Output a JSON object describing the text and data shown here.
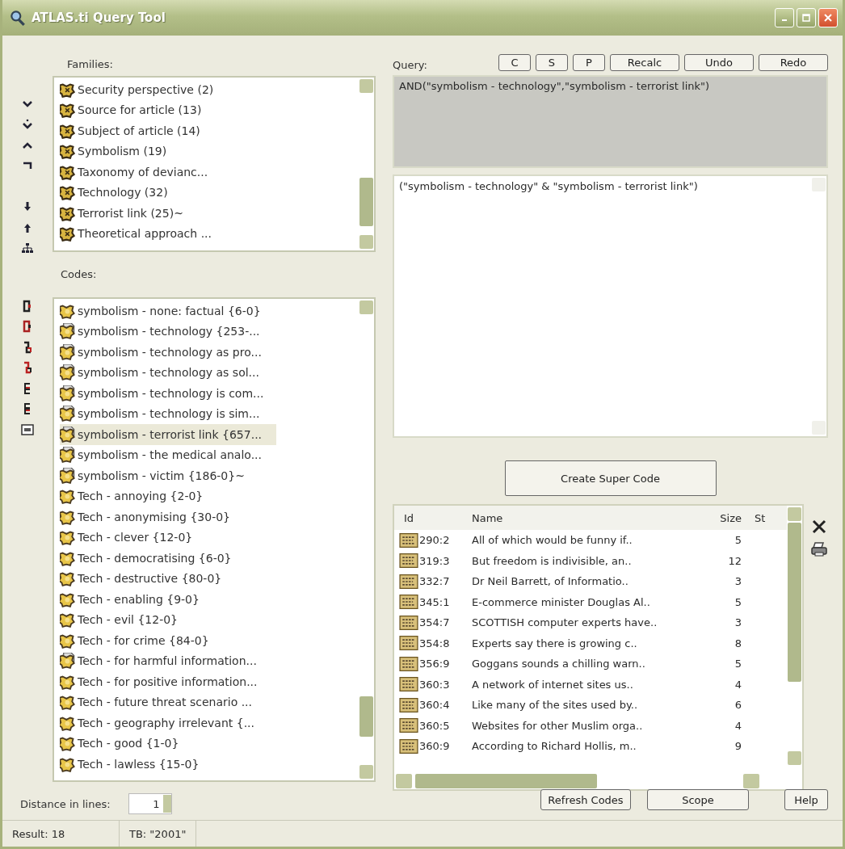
{
  "window": {
    "title": "ATLAS.ti Query Tool"
  },
  "families": {
    "label": "Families:",
    "items": [
      {
        "label": "Security perspective (2)"
      },
      {
        "label": "Source for article (13)"
      },
      {
        "label": "Subject of article (14)"
      },
      {
        "label": "Symbolism (19)"
      },
      {
        "label": "Taxonomy of devianc..."
      },
      {
        "label": "Technology (32)"
      },
      {
        "label": "Terrorist link (25)~"
      },
      {
        "label": "Theoretical approach ..."
      }
    ]
  },
  "codes": {
    "label": "Codes:",
    "items": [
      {
        "label": "symbolism - none: factual {6-0}",
        "commented": false,
        "selected": false
      },
      {
        "label": "symbolism - technology {253-...",
        "commented": true,
        "selected": false
      },
      {
        "label": "symbolism - technology as pro...",
        "commented": true,
        "selected": false
      },
      {
        "label": "symbolism - technology as sol...",
        "commented": true,
        "selected": false
      },
      {
        "label": "symbolism - technology is com...",
        "commented": true,
        "selected": false
      },
      {
        "label": "symbolism - technology is sim...",
        "commented": true,
        "selected": false
      },
      {
        "label": "symbolism - terrorist link {657...",
        "commented": true,
        "selected": true
      },
      {
        "label": "symbolism - the medical analo...",
        "commented": true,
        "selected": false
      },
      {
        "label": "symbolism - victim {186-0}~",
        "commented": true,
        "selected": false
      },
      {
        "label": "Tech - annoying {2-0}",
        "commented": false,
        "selected": false
      },
      {
        "label": "Tech - anonymising {30-0}",
        "commented": false,
        "selected": false
      },
      {
        "label": "Tech - clever {12-0}",
        "commented": false,
        "selected": false
      },
      {
        "label": "Tech - democratising {6-0}",
        "commented": false,
        "selected": false
      },
      {
        "label": "Tech - destructive {80-0}",
        "commented": false,
        "selected": false
      },
      {
        "label": "Tech - enabling {9-0}",
        "commented": false,
        "selected": false
      },
      {
        "label": "Tech - evil {12-0}",
        "commented": false,
        "selected": false
      },
      {
        "label": "Tech - for crime {84-0}",
        "commented": false,
        "selected": false
      },
      {
        "label": "Tech - for harmful information...",
        "commented": true,
        "selected": false
      },
      {
        "label": "Tech - for positive information...",
        "commented": false,
        "selected": false
      },
      {
        "label": "Tech - future threat scenario ...",
        "commented": false,
        "selected": false
      },
      {
        "label": "Tech - geography irrelevant {...",
        "commented": false,
        "selected": false
      },
      {
        "label": "Tech - good {1-0}",
        "commented": false,
        "selected": false
      },
      {
        "label": "Tech - lawless {15-0}",
        "commented": false,
        "selected": false
      }
    ]
  },
  "distance": {
    "label": "Distance in lines:",
    "value": "1"
  },
  "query": {
    "label": "Query:",
    "buttons": [
      "C",
      "S",
      "P",
      "Recalc",
      "Undo",
      "Redo"
    ],
    "expression": "AND(\"symbolism - technology\",\"symbolism - terrorist link\")",
    "translation": "(\"symbolism - technology\" & \"symbolism - terrorist link\")"
  },
  "create_button": "Create Super Code",
  "results": {
    "columns": [
      "Id",
      "Name",
      "Size",
      "St"
    ],
    "rows": [
      {
        "id": "290:2",
        "name": "All of which would be funny if..",
        "size": "5"
      },
      {
        "id": "319:3",
        "name": "But freedom is indivisible, an..",
        "size": "12"
      },
      {
        "id": "332:7",
        "name": "Dr Neil Barrett, of Informatio..",
        "size": "3"
      },
      {
        "id": "345:1",
        "name": "E-commerce minister Douglas Al..",
        "size": "5"
      },
      {
        "id": "354:7",
        "name": "SCOTTISH computer experts have..",
        "size": "3"
      },
      {
        "id": "354:8",
        "name": "Experts say there is growing c..",
        "size": "8"
      },
      {
        "id": "356:9",
        "name": "Goggans sounds a chilling warn..",
        "size": "5"
      },
      {
        "id": "360:3",
        "name": "A network of internet sites us..",
        "size": "4"
      },
      {
        "id": "360:4",
        "name": "Like many of the sites used by..",
        "size": "6"
      },
      {
        "id": "360:5",
        "name": "Websites for other Muslim orga..",
        "size": "4"
      },
      {
        "id": "360:9",
        "name": "According to Richard Hollis, m..",
        "size": "9"
      }
    ]
  },
  "bottom_buttons": [
    "Refresh Codes",
    "Scope",
    "Help"
  ],
  "status_bar": [
    "Result: 18",
    "TB: \"2001\""
  ]
}
